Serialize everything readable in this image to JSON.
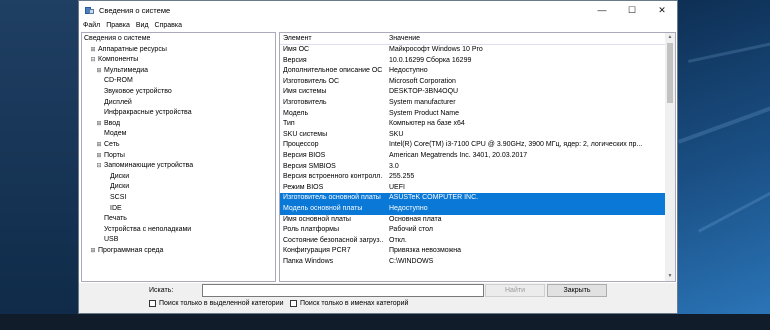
{
  "window": {
    "title": "Сведения о системе",
    "controls": {
      "minimize": "—",
      "maximize": "☐",
      "close": "✕"
    }
  },
  "menu": [
    "Файл",
    "Правка",
    "Вид",
    "Справка"
  ],
  "tree": [
    {
      "label": "Сведения о системе",
      "level": 0,
      "toggle": ""
    },
    {
      "label": "Аппаратные ресурсы",
      "level": 1,
      "toggle": "⊞"
    },
    {
      "label": "Компоненты",
      "level": 1,
      "toggle": "⊟"
    },
    {
      "label": "Мультимедиа",
      "level": 2,
      "toggle": "⊞"
    },
    {
      "label": "CD-ROM",
      "level": 2,
      "toggle": ""
    },
    {
      "label": "Звуковое устройство",
      "level": 2,
      "toggle": ""
    },
    {
      "label": "Дисплей",
      "level": 2,
      "toggle": ""
    },
    {
      "label": "Инфракрасные устройства",
      "level": 2,
      "toggle": ""
    },
    {
      "label": "Ввод",
      "level": 2,
      "toggle": "⊞"
    },
    {
      "label": "Модем",
      "level": 2,
      "toggle": ""
    },
    {
      "label": "Сеть",
      "level": 2,
      "toggle": "⊞"
    },
    {
      "label": "Порты",
      "level": 2,
      "toggle": "⊞"
    },
    {
      "label": "Запоминающие устройства",
      "level": 2,
      "toggle": "⊟"
    },
    {
      "label": "Диски",
      "level": 3,
      "toggle": ""
    },
    {
      "label": "Диски",
      "level": 3,
      "toggle": ""
    },
    {
      "label": "SCSI",
      "level": 3,
      "toggle": ""
    },
    {
      "label": "IDE",
      "level": 3,
      "toggle": ""
    },
    {
      "label": "Печать",
      "level": 2,
      "toggle": ""
    },
    {
      "label": "Устройства с неполадками",
      "level": 2,
      "toggle": ""
    },
    {
      "label": "USB",
      "level": 2,
      "toggle": ""
    },
    {
      "label": "Программная среда",
      "level": 1,
      "toggle": "⊞"
    }
  ],
  "details": {
    "columns": [
      "Элемент",
      "Значение"
    ],
    "rows": [
      {
        "item": "Имя ОС",
        "value": "Майкрософт Windows 10 Pro",
        "selected": false
      },
      {
        "item": "Версия",
        "value": "10.0.16299 Сборка 16299",
        "selected": false
      },
      {
        "item": "Дополнительное описание ОС",
        "value": "Недоступно",
        "selected": false
      },
      {
        "item": "Изготовитель ОС",
        "value": "Microsoft Corporation",
        "selected": false
      },
      {
        "item": "Имя системы",
        "value": "DESKTOP-3BN4OQU",
        "selected": false
      },
      {
        "item": "Изготовитель",
        "value": "System manufacturer",
        "selected": false
      },
      {
        "item": "Модель",
        "value": "System Product Name",
        "selected": false
      },
      {
        "item": "Тип",
        "value": "Компьютер на базе x64",
        "selected": false
      },
      {
        "item": "SKU системы",
        "value": "SKU",
        "selected": false
      },
      {
        "item": "Процессор",
        "value": "Intel(R) Core(TM) i3-7100 CPU @ 3.90GHz, 3900 МГц, ядер: 2, логических пр...",
        "selected": false
      },
      {
        "item": "Версия BIOS",
        "value": "American Megatrends Inc. 3401, 20.03.2017",
        "selected": false
      },
      {
        "item": "Версия SMBIOS",
        "value": "3.0",
        "selected": false
      },
      {
        "item": "Версия встроенного контролл...",
        "value": "255.255",
        "selected": false
      },
      {
        "item": "Режим BIOS",
        "value": "UEFI",
        "selected": false
      },
      {
        "item": "Изготовитель основной платы",
        "value": "ASUSTeK COMPUTER INC.",
        "selected": true
      },
      {
        "item": "Модель основной платы",
        "value": "Недоступно",
        "selected": true
      },
      {
        "item": "Имя основной платы",
        "value": "Основная плата",
        "selected": false
      },
      {
        "item": "Роль платформы",
        "value": "Рабочий стол",
        "selected": false
      },
      {
        "item": "Состояние безопасной загруз...",
        "value": "Откл.",
        "selected": false
      },
      {
        "item": "Конфигурация PCR7",
        "value": "Привязка невозможна",
        "selected": false
      },
      {
        "item": "Папка Windows",
        "value": "C:\\WINDOWS",
        "selected": false
      }
    ]
  },
  "search": {
    "label": "Искать:",
    "value": "",
    "find_button": "Найти",
    "close_button": "Закрыть",
    "option_selected_category": "Поиск только в выделенной категории",
    "option_category_names": "Поиск только в именах категорий"
  },
  "colors": {
    "selection": "#0a78d7"
  }
}
